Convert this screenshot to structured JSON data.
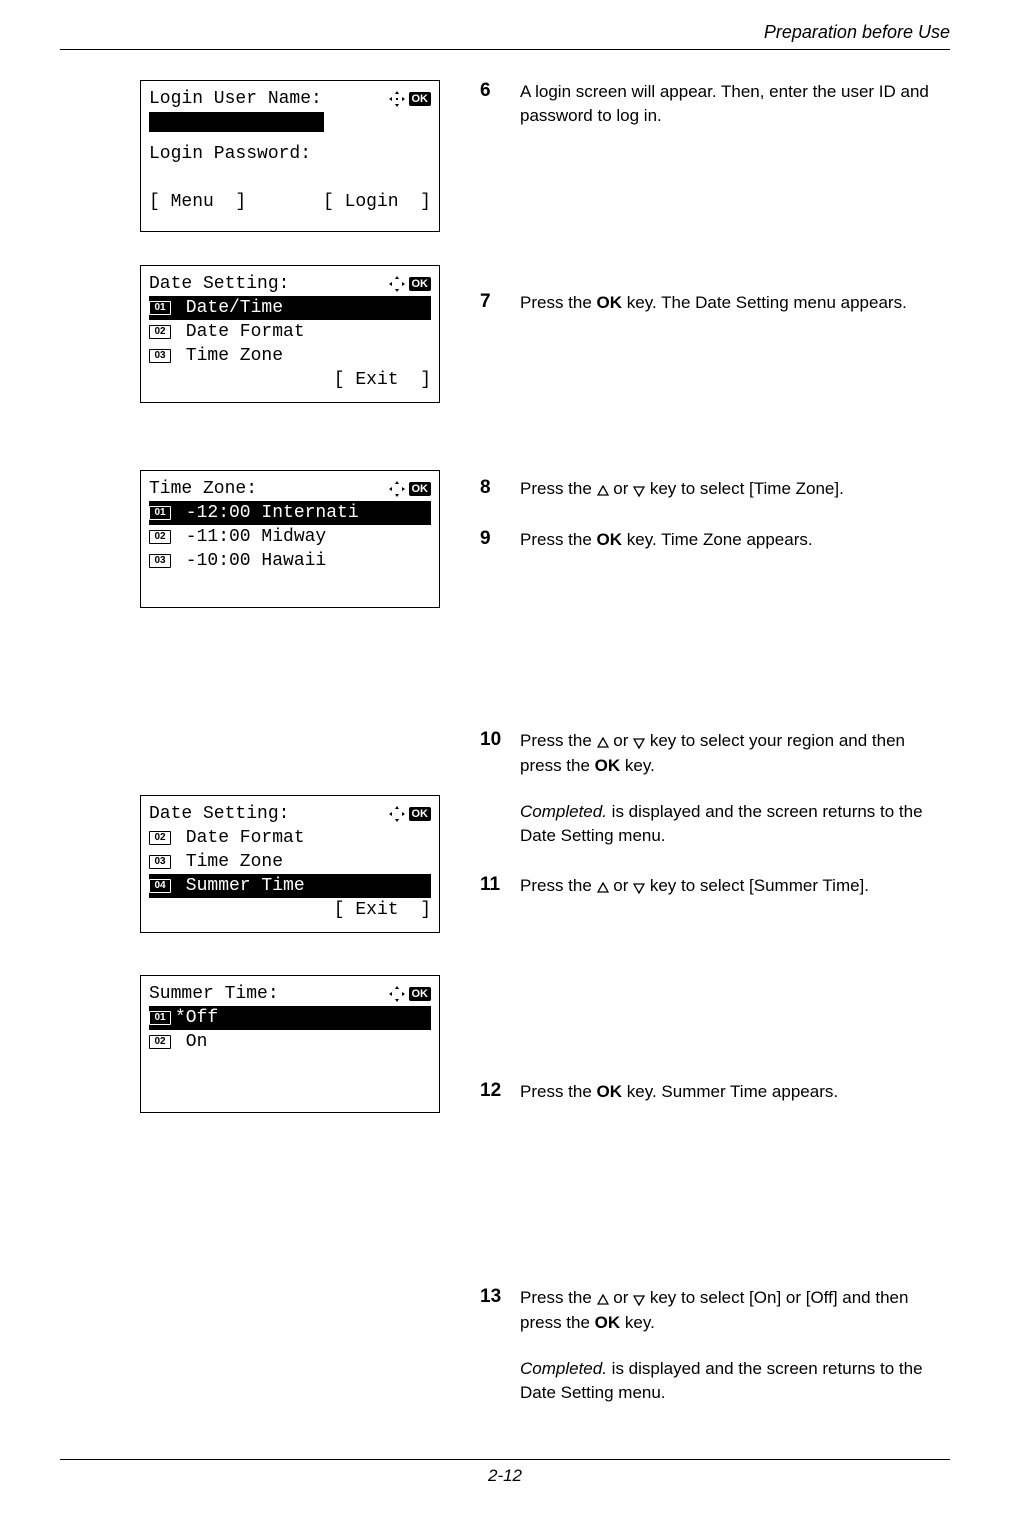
{
  "header": {
    "title": "Preparation before Use"
  },
  "footer": {
    "page": "2-12"
  },
  "icons": {
    "ok": "OK"
  },
  "lcd1": {
    "title": "Login User Name:",
    "pw_label": "Login Password:",
    "menu": "[ Menu  ]",
    "login": "[ Login  ]"
  },
  "lcd2": {
    "title": "Date Setting:",
    "r1_num": "01",
    "r1": " Date/Time",
    "r2_num": "02",
    "r2": " Date Format",
    "r3_num": "03",
    "r3": " Time Zone",
    "exit": "[ Exit  ]"
  },
  "lcd3": {
    "title": "Time Zone:",
    "r1_num": "01",
    "r1": " -12:00 Internati",
    "r2_num": "02",
    "r2": " -11:00 Midway",
    "r3_num": "03",
    "r3": " -10:00 Hawaii"
  },
  "lcd4": {
    "title": "Date Setting:",
    "r1_num": "02",
    "r1": " Date Format",
    "r2_num": "03",
    "r2": " Time Zone",
    "r3_num": "04",
    "r3": " Summer Time",
    "exit": "[ Exit  ]"
  },
  "lcd5": {
    "title": "Summer Time:",
    "r1_num": "01",
    "r1": "*Off",
    "r2_num": "02",
    "r2": " On"
  },
  "steps": {
    "s6": {
      "num": "6",
      "text": "A login screen will appear. Then, enter the user ID and password to log in."
    },
    "s7": {
      "num": "7",
      "pre": "Press the ",
      "bold1": "OK",
      "post": " key. The Date Setting menu appears."
    },
    "s8": {
      "num": "8",
      "pre": "Press the ",
      "mid": " or ",
      "post": " key to select [Time Zone]."
    },
    "s9": {
      "num": "9",
      "pre": "Press the ",
      "bold1": "OK",
      "post": " key. Time Zone appears."
    },
    "s10": {
      "num": "10",
      "pre": "Press the ",
      "mid": " or ",
      "post1": " key to select your region and then press the ",
      "bold1": "OK",
      "post2": " key.",
      "p2a": "Completed.",
      "p2b": " is displayed and the screen returns to the Date Setting menu."
    },
    "s11": {
      "num": "11",
      "pre": "Press the ",
      "mid": " or ",
      "post": " key to select [Summer Time]."
    },
    "s12": {
      "num": "12",
      "pre": "Press the ",
      "bold1": "OK",
      "post": " key. Summer Time appears."
    },
    "s13": {
      "num": "13",
      "pre": "Press the ",
      "mid": " or ",
      "post1": " key to select [On] or [Off] and then press the ",
      "bold1": "OK",
      "post2": " key.",
      "p2a": "Completed.",
      "p2b": " is displayed and the screen returns to the Date Setting menu."
    }
  }
}
